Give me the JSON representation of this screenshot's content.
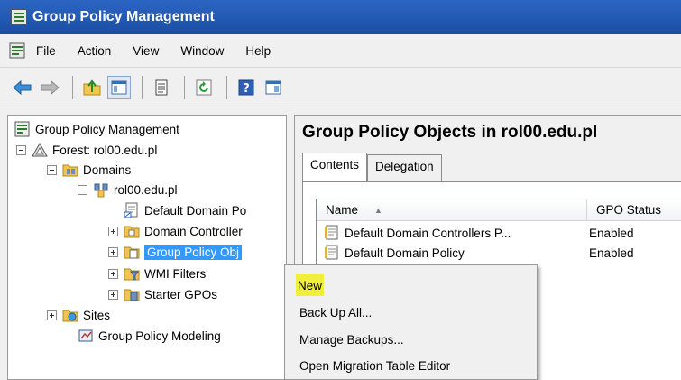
{
  "window": {
    "title": "Group Policy Management"
  },
  "menu": {
    "items": [
      "File",
      "Action",
      "View",
      "Window",
      "Help"
    ]
  },
  "toolbar": {
    "icons": [
      "back-arrow-icon",
      "forward-arrow-icon",
      "up-folder-icon",
      "show-tree-icon",
      "properties-icon",
      "refresh-icon",
      "help-icon",
      "console-icon"
    ]
  },
  "tree": {
    "root": "Group Policy Management",
    "forest": "Forest: rol00.edu.pl",
    "domains": "Domains",
    "domain": "rol00.edu.pl",
    "default_policy": "Default Domain Po",
    "domain_controllers": "Domain Controller",
    "gpo": "Group Policy Obj",
    "wmi": "WMI Filters",
    "starter": "Starter GPOs",
    "sites": "Sites",
    "modeling": "Group Policy Modeling"
  },
  "right": {
    "heading": "Group Policy Objects in rol00.edu.pl",
    "tabs": [
      "Contents",
      "Delegation"
    ],
    "columns": {
      "name": "Name",
      "status": "GPO Status"
    },
    "rows": [
      {
        "name": "Default Domain Controllers P...",
        "status": "Enabled"
      },
      {
        "name": "Default Domain Policy",
        "status": "Enabled"
      }
    ]
  },
  "context_menu": {
    "items": [
      "New",
      "Back Up All...",
      "Manage Backups...",
      "Open Migration Table Editor"
    ]
  },
  "colors": {
    "title_bar": "#1b4ea3",
    "selection": "#3399ff",
    "highlight": "#f2ee3c"
  }
}
